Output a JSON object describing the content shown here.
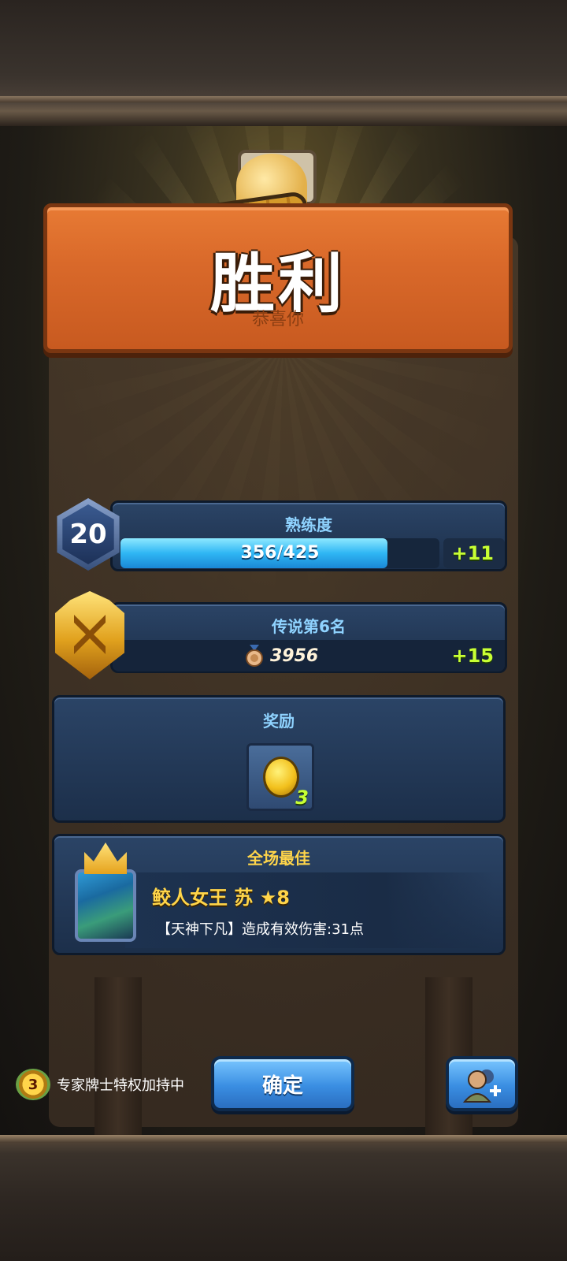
{
  "result": {
    "title": "胜利",
    "subtitle": "恭喜你"
  },
  "proficiency": {
    "label": "熟练度",
    "level": "20",
    "progress_text": "356/425",
    "progress_fraction": 0.8376,
    "gain": "+11"
  },
  "rank": {
    "label": "传说第6名",
    "score": "3956",
    "gain": "+15"
  },
  "rewards": {
    "label": "奖励",
    "items": [
      {
        "icon": "gold-coin-icon",
        "count": "3"
      }
    ]
  },
  "mvp": {
    "label": "全场最佳",
    "hero_name": "鲛人女王 苏 ★8",
    "description": "【天神下凡】造成有效伤害:31点"
  },
  "footer": {
    "privilege_level": "3",
    "privilege_text": "专家牌士特权加持中",
    "confirm_label": "确定"
  },
  "colors": {
    "plank": "#d9692a",
    "panel": "#2b4466",
    "gain": "#c8ff33",
    "mvp_title": "#ffd54a",
    "button": "#3a8ee2"
  }
}
